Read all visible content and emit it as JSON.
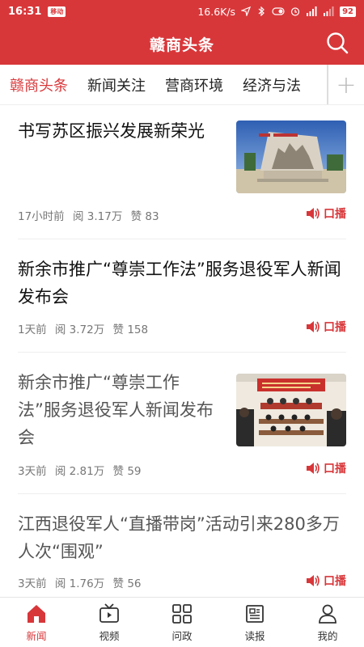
{
  "status_bar": {
    "time": "16:31",
    "carrier_badge": "移动",
    "net_speed": "16.6K/s",
    "battery": "92"
  },
  "header": {
    "title": "赣商头条"
  },
  "tabs": [
    {
      "label": "赣商头条",
      "active": true
    },
    {
      "label": "新闻关注",
      "active": false
    },
    {
      "label": "营商环境",
      "active": false
    },
    {
      "label": "经济与法",
      "active": false
    }
  ],
  "tabs_add_label": "+",
  "articles": [
    {
      "title": "书写苏区振兴发展新荣光",
      "time": "17小时前",
      "reads": "阅 3.17万",
      "likes": "赞 83",
      "audio_label": "口播",
      "has_thumb": true,
      "thumb_caption": "苏区振兴纪念"
    },
    {
      "title": "新余市推广“尊崇工作法”服务退役军人新闻发布会",
      "time": "1天前",
      "reads": "阅 3.72万",
      "likes": "赞 158",
      "audio_label": "口播",
      "has_thumb": false
    },
    {
      "title": "新余市推广“尊崇工作法”服务退役军人新闻发布会",
      "time": "3天前",
      "reads": "阅 2.81万",
      "likes": "赞 59",
      "audio_label": "口播",
      "has_thumb": true
    },
    {
      "title": "江西退役军人“直播带岗”活动引来280多万人次“围观”",
      "time": "3天前",
      "reads": "阅 1.76万",
      "likes": "赞 56",
      "audio_label": "口播",
      "has_thumb": false
    }
  ],
  "bottom_nav": [
    {
      "label": "新闻",
      "icon": "home-icon",
      "active": true
    },
    {
      "label": "视频",
      "icon": "tv-icon",
      "active": false
    },
    {
      "label": "问政",
      "icon": "grid-icon",
      "active": false
    },
    {
      "label": "读报",
      "icon": "newspaper-icon",
      "active": false
    },
    {
      "label": "我的",
      "icon": "user-icon",
      "active": false
    }
  ],
  "colors": {
    "brand_red": "#d8373a",
    "meta_grey": "#777777"
  }
}
